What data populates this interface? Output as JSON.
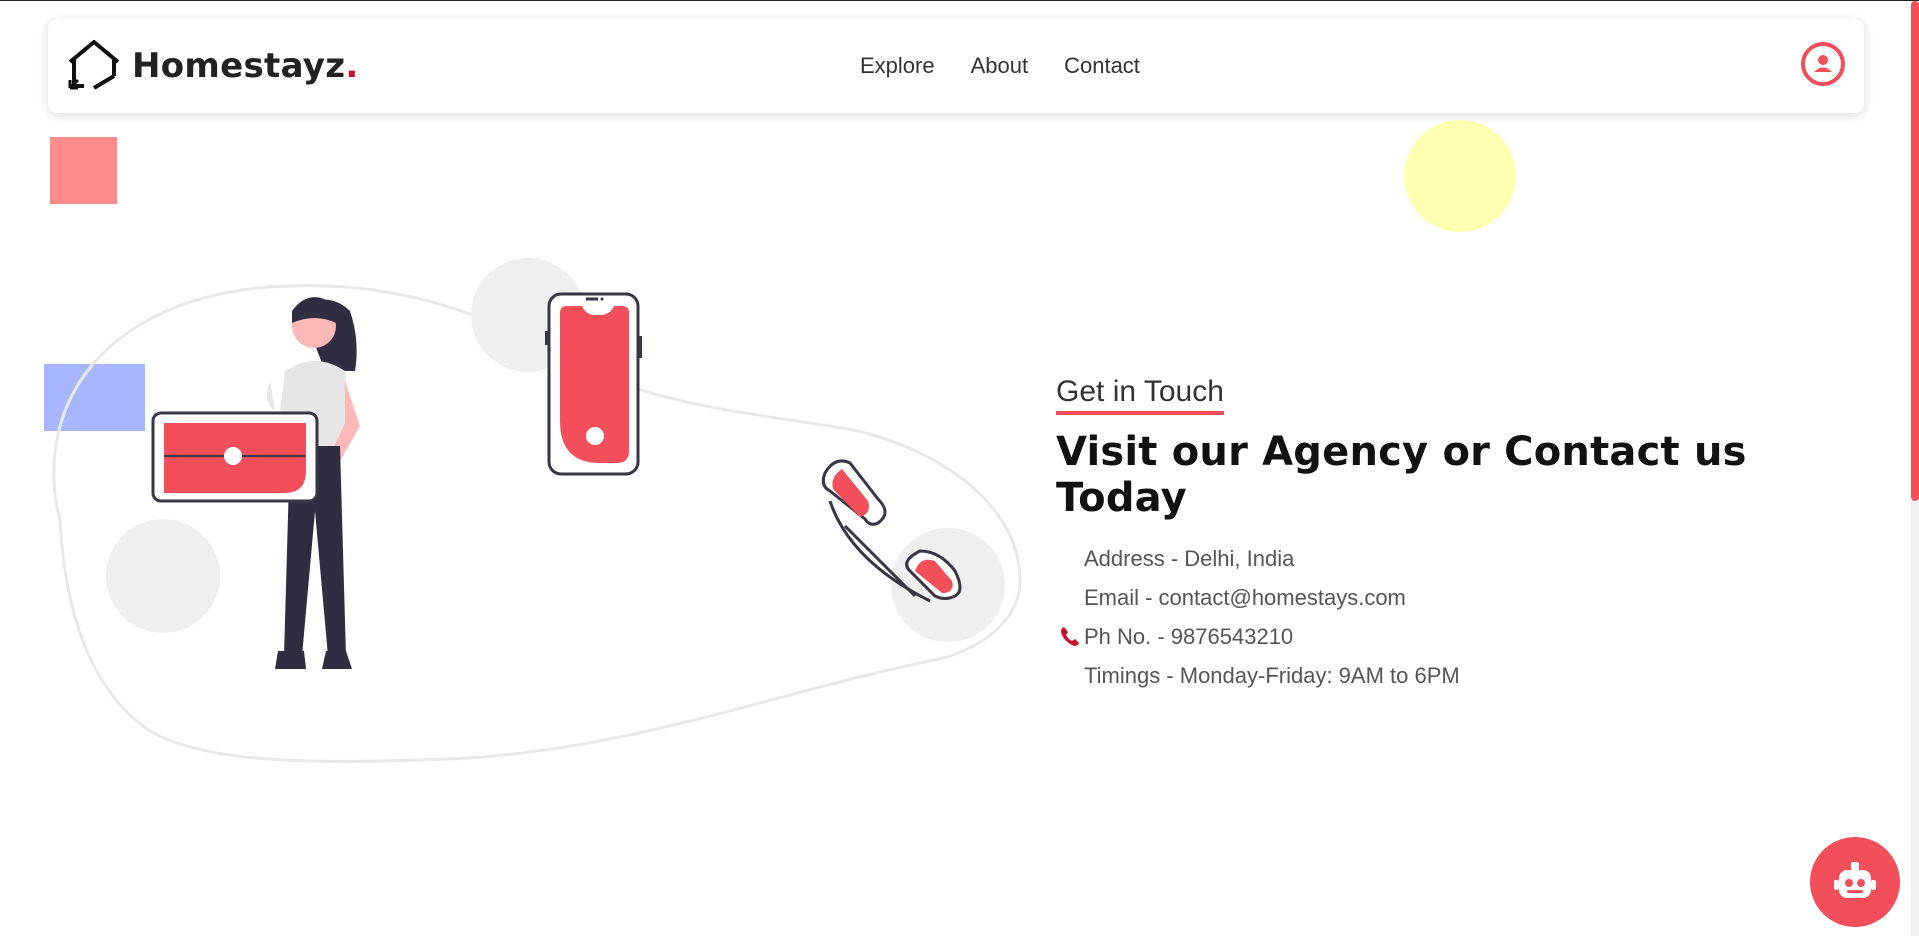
{
  "brand": {
    "name": "Homestayz",
    "dot": ".",
    "logo_icon": "house-logo-icon"
  },
  "nav": {
    "links": [
      {
        "label": "Explore"
      },
      {
        "label": "About"
      },
      {
        "label": "Contact"
      }
    ],
    "user_icon": "user-circle-icon"
  },
  "contact": {
    "eyebrow": "Get in Touch",
    "headline": "Visit our Agency or Contact us Today",
    "items": [
      {
        "icon": "location-icon",
        "text": "Address - Delhi, India"
      },
      {
        "icon": "email-icon",
        "text": "Email - contact@homestays.com"
      },
      {
        "icon": "phone-icon",
        "text": "Ph No. - 9876543210"
      },
      {
        "icon": "clock-icon",
        "text": "Timings - Monday-Friday: 9AM to 6PM"
      }
    ]
  },
  "chatbot": {
    "icon": "robot-icon"
  },
  "colors": {
    "accent": "#f34f5a",
    "brand_dot": "#c8102e",
    "deco_square": "#ff8a8a",
    "deco_yellow": "#ffffb0",
    "deco_blue": "#a8b6ff",
    "text_dark": "#111111"
  }
}
